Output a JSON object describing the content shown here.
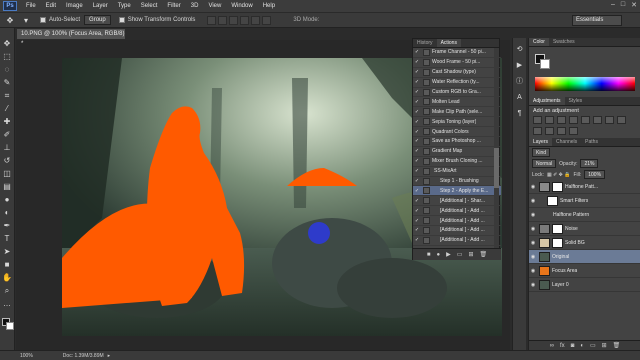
{
  "menubar": {
    "logo": "Ps",
    "items": [
      "File",
      "Edit",
      "Image",
      "Layer",
      "Type",
      "Select",
      "Filter",
      "3D",
      "View",
      "Window",
      "Help"
    ],
    "window_controls": [
      "–",
      "□",
      "✕"
    ]
  },
  "options": {
    "auto_select_label": "Auto-Select",
    "group_value": "Group",
    "show_transform_label": "Show Transform Controls",
    "mode_3d_label": "3D Mode:",
    "workspace_value": "Essentials"
  },
  "document": {
    "tab_title": "10.PNG @ 100% (Focus Area, RGB/8) *",
    "zoom": "100%",
    "doc_info": "Doc: 1.39M/3.89M"
  },
  "actions_panel": {
    "tabs": [
      "History",
      "Actions"
    ],
    "items": [
      {
        "label": "Frame Channel - 50 pi...",
        "checked": true,
        "selected": false
      },
      {
        "label": "Wood Frame - 50 pi...",
        "checked": true,
        "selected": false
      },
      {
        "label": "Cast Shadow (type)",
        "checked": true,
        "selected": false
      },
      {
        "label": "Water Reflection (ty...",
        "checked": true,
        "selected": false
      },
      {
        "label": "Custom RGB to Gra...",
        "checked": true,
        "selected": false
      },
      {
        "label": "Molten Lead",
        "checked": true,
        "selected": false
      },
      {
        "label": "Make Clip Path (sele...",
        "checked": true,
        "selected": false
      },
      {
        "label": "Sepia Toning (layer)",
        "checked": true,
        "selected": false
      },
      {
        "label": "Quadrant Colors",
        "checked": true,
        "selected": false
      },
      {
        "label": "Save as Photoshop ...",
        "checked": true,
        "selected": false
      },
      {
        "label": "Gradient Map",
        "checked": true,
        "selected": false
      },
      {
        "label": "Mixer Brush Cloning ...",
        "checked": true,
        "selected": false
      },
      {
        "label": "SS-MixArt",
        "checked": true,
        "selected": false
      },
      {
        "label": "Step 1 - Brushing",
        "checked": true,
        "selected": false
      },
      {
        "label": "Step 2 - Apply the E...",
        "checked": true,
        "selected": true
      },
      {
        "label": "[Additional ] - Shar...",
        "checked": true,
        "selected": false
      },
      {
        "label": "[Additional ] - Add ...",
        "checked": true,
        "selected": false
      },
      {
        "label": "[Additional ] - Add ...",
        "checked": true,
        "selected": false
      },
      {
        "label": "[Additional ] - Add ...",
        "checked": true,
        "selected": false
      },
      {
        "label": "[Additional ] - Add ...",
        "checked": true,
        "selected": false
      }
    ]
  },
  "right_panels": {
    "color_tabs": [
      "Color",
      "Swatches"
    ],
    "adjust_tabs": [
      "Adjustments",
      "Styles"
    ],
    "adjust_heading": "Add an adjustment",
    "layer_tabs": [
      "Layers",
      "Channels",
      "Paths"
    ],
    "kind_value": "Kind",
    "blend_mode": "Normal",
    "opacity_label": "Opacity:",
    "opacity_value": "21%",
    "lock_label": "Lock:",
    "fill_label": "Fill:",
    "fill_value": "100%",
    "layers": [
      {
        "name": "Halftone Patt...",
        "selected": false,
        "thumb": "#8a8a8a",
        "has_mask": true,
        "indent": 0
      },
      {
        "name": "Smart Filters",
        "selected": false,
        "thumb": "#ffffff",
        "has_mask": false,
        "indent": 1
      },
      {
        "name": "Halftone Pattern",
        "selected": false,
        "thumb": "",
        "has_mask": false,
        "indent": 2
      },
      {
        "name": "Noise",
        "selected": false,
        "thumb": "#7a7a7a",
        "has_mask": true,
        "indent": 0
      },
      {
        "name": "Solid BG",
        "selected": false,
        "thumb": "#d6c6a6",
        "has_mask": true,
        "indent": 0
      },
      {
        "name": "Original",
        "selected": true,
        "thumb": "#4a5a50",
        "has_mask": false,
        "indent": 0
      },
      {
        "name": "Focus Area",
        "selected": false,
        "thumb": "#e8751a",
        "has_mask": false,
        "indent": 0
      },
      {
        "name": "Layer 0",
        "selected": false,
        "thumb": "#4a5a50",
        "has_mask": false,
        "indent": 0
      }
    ]
  },
  "colors": {
    "overlay_orange": "#ff5a00",
    "blue_dot": "#2c3ad8",
    "selection_blue": "#5a6a8a"
  }
}
